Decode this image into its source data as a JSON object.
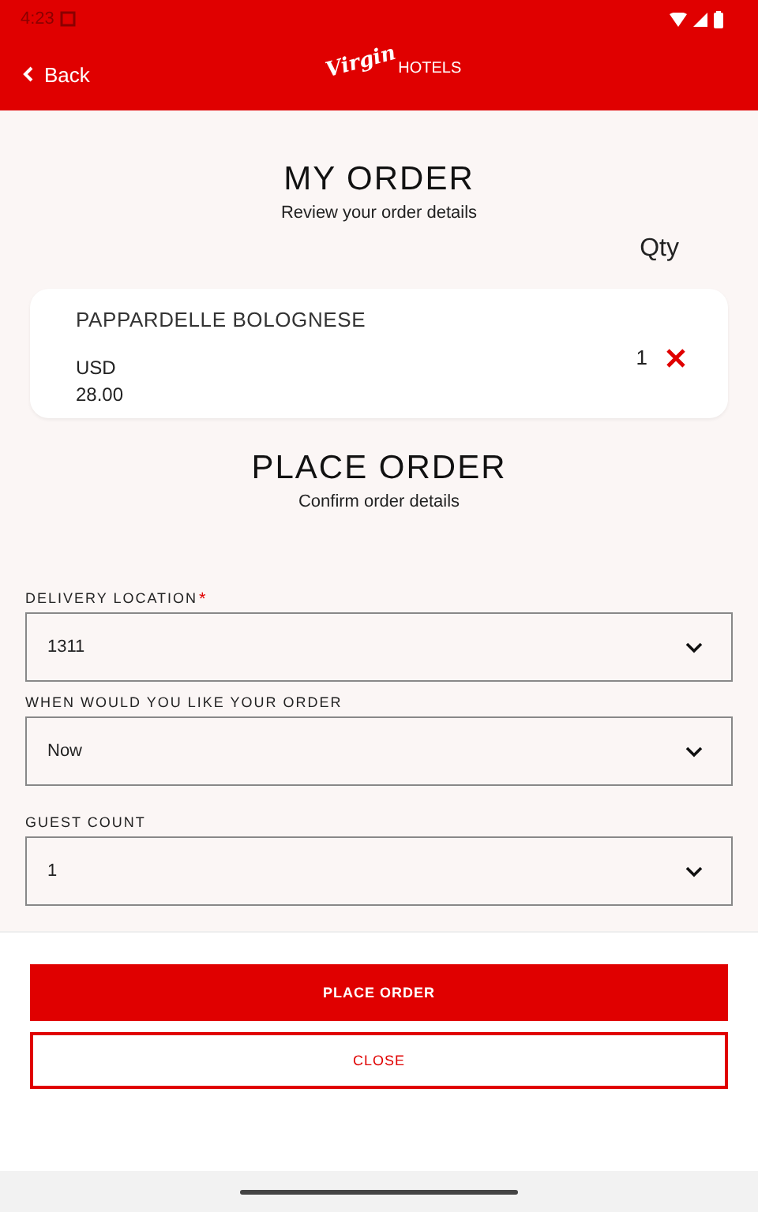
{
  "status_bar": {
    "time": "4:23"
  },
  "header": {
    "back": "Back",
    "logo_script": "Virgin",
    "logo_word": "HOTELS"
  },
  "my_order": {
    "title": "MY ORDER",
    "subtitle": "Review your order details",
    "qty_heading": "Qty",
    "items": [
      {
        "name": "PAPPARDELLE BOLOGNESE",
        "currency": "USD",
        "price": "28.00",
        "qty": "1"
      }
    ]
  },
  "place_order": {
    "title": "PLACE ORDER",
    "subtitle": "Confirm order details"
  },
  "fields": [
    {
      "label": "DELIVERY LOCATION",
      "required_mark": "*",
      "value": "1311"
    },
    {
      "label": "WHEN WOULD YOU LIKE YOUR ORDER",
      "value": "Now"
    },
    {
      "label": "GUEST COUNT",
      "value": "1"
    }
  ],
  "buttons": [
    {
      "label": "PLACE ORDER",
      "kind": "primary"
    },
    {
      "label": "CLOSE",
      "kind": "outline"
    }
  ]
}
